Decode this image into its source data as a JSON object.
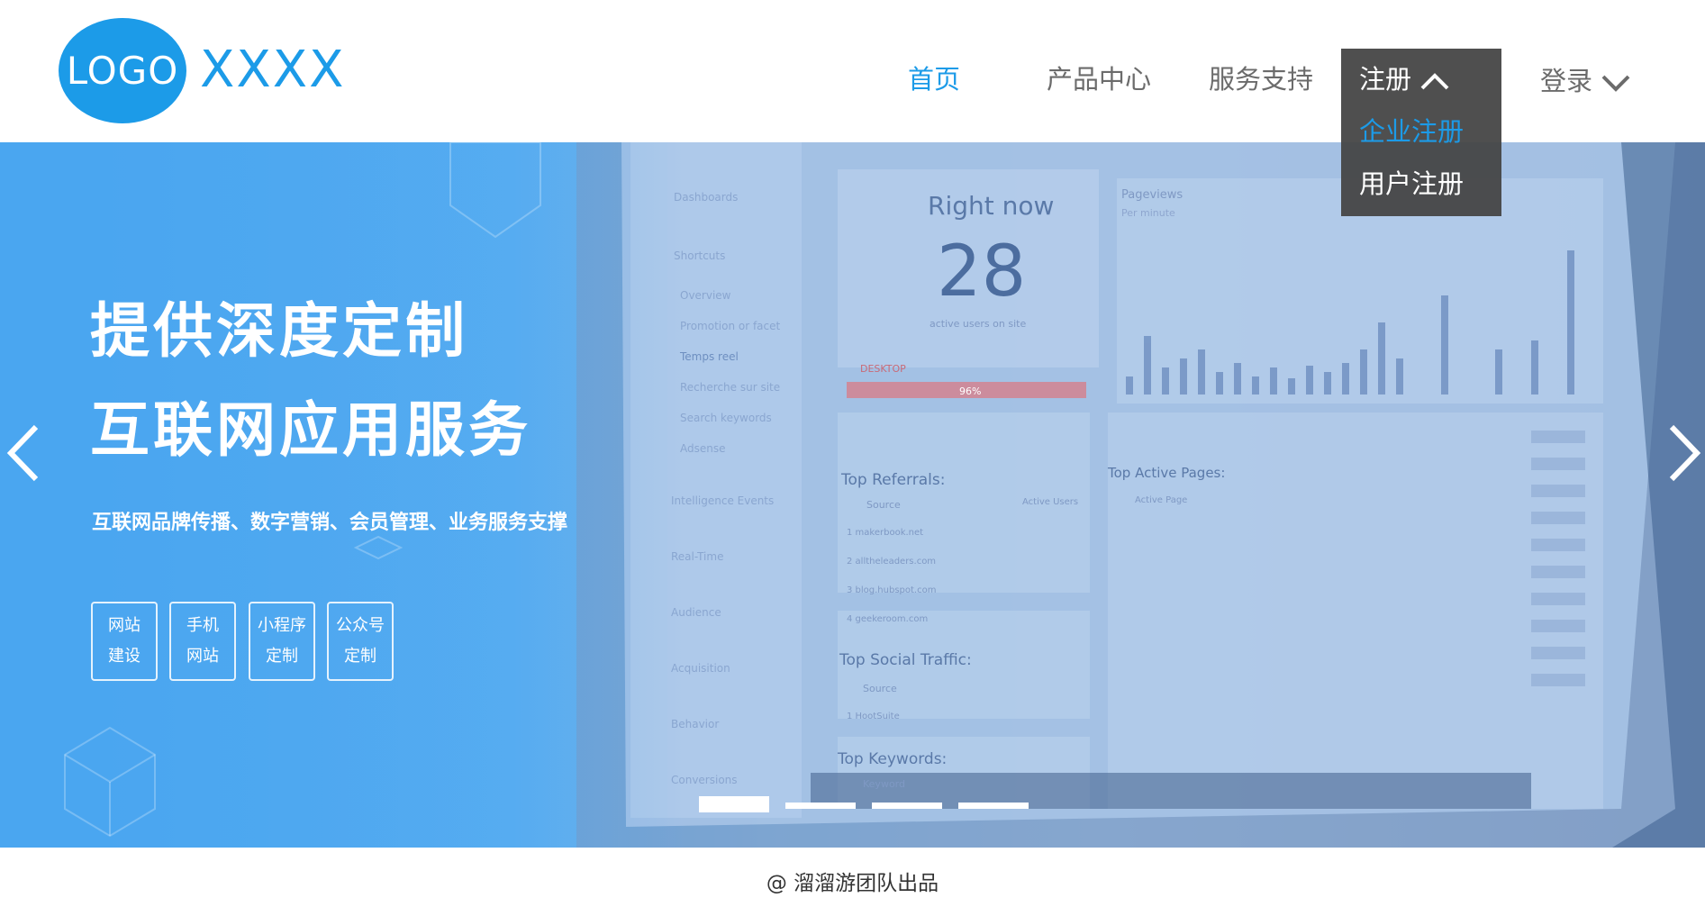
{
  "logo": {
    "mark": "LOGO",
    "name": "XXXX"
  },
  "nav": {
    "home": "首页",
    "products": "产品中心",
    "service": "服务支持",
    "register": "注册",
    "login": "登录"
  },
  "register_menu": {
    "items": [
      "企业注册",
      "用户注册"
    ]
  },
  "banner": {
    "title_line1": "提供深度定制",
    "title_line2": "互联网应用服务",
    "subtitle": "互联网品牌传播、数字营销、会员管理、业务服务支撑",
    "tags": [
      {
        "line1": "网站",
        "line2": "建设"
      },
      {
        "line1": "手机",
        "line2": "网站"
      },
      {
        "line1": "小程序",
        "line2": "定制"
      },
      {
        "line1": "公众号",
        "line2": "定制"
      }
    ],
    "slide_count": 4,
    "active_slide": 1,
    "screen": {
      "right_now_label": "Right now",
      "right_now_value": "28",
      "active_users_label": "active users on site",
      "desktop_label": "DESKTOP",
      "desktop_bar_label": "96%",
      "pageviews_label": "Pageviews",
      "pageviews_sub": "Per minute",
      "top_referrals": "Top Referrals:",
      "top_active_pages": "Top Active Pages:",
      "top_social": "Top Social Traffic:",
      "top_keywords": "Top Keywords:",
      "source_col": "Source",
      "active_users_col": "Active Users",
      "active_page_col": "Active Page",
      "keyword_col": "Keyword",
      "sidebar": [
        "Dashboards",
        "Shortcuts",
        "Overview",
        "Promotion or facet",
        "Temps reel",
        "Recherche sur site",
        "Search keywords",
        "Adsense",
        "Intelligence Events",
        "Real-Time",
        "Audience",
        "Acquisition",
        "Behavior",
        "Conversions"
      ],
      "referrals": [
        "1 makerbook.net",
        "2 alltheleaders.com",
        "3 blog.hubspot.com",
        "4 geekeroom.com"
      ],
      "social": [
        "1 HootSuite"
      ]
    }
  },
  "footer": {
    "text": "@ 溜溜游团队出品"
  },
  "colors": {
    "brand": "#1c9be8",
    "nav_text": "#6b6b6b",
    "dropdown_bg": "#444444"
  }
}
